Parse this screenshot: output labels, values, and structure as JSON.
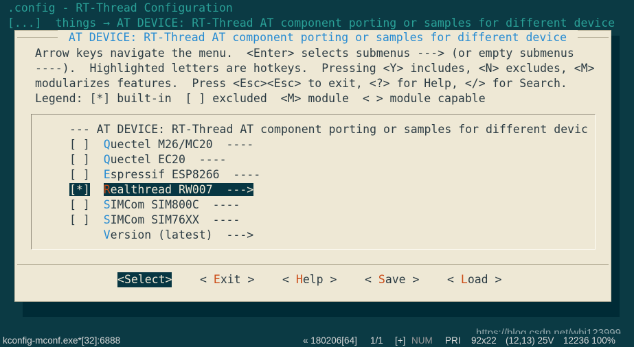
{
  "window": {
    "title": ".config - RT-Thread Configuration",
    "breadcrumb": "[...]  things → AT DEVICE: RT-Thread AT component porting or samples for different device"
  },
  "dialog": {
    "title": " AT DEVICE: RT-Thread AT component porting or samples for different device ",
    "help_lines": [
      "Arrow keys navigate the menu.  <Enter> selects submenus ---> (or empty submenus",
      "----).  Highlighted letters are hotkeys.  Pressing <Y> includes, <N> excludes, <M>",
      "modularizes features.  Press <Esc><Esc> to exit, <?> for Help, </> for Search.",
      "Legend: [*] built-in  [ ] excluded  <M> module  < > module capable"
    ],
    "menu_header": "--- AT DEVICE: RT-Thread AT component porting or samples for different devic",
    "menu_items": [
      {
        "box": "[ ]",
        "hotkey": "Q",
        "label": "uectel M26/MC20  ----"
      },
      {
        "box": "[ ]",
        "hotkey": "Q",
        "label": "uectel EC20  ----"
      },
      {
        "box": "[ ]",
        "hotkey": "E",
        "label": "spressif ESP8266  ----"
      },
      {
        "box": "[*]",
        "hotkey": "R",
        "label": "ealthread RW007  --->"
      },
      {
        "box": "[ ]",
        "hotkey": "S",
        "label": "IMCom SIM800C  ----"
      },
      {
        "box": "[ ]",
        "hotkey": "S",
        "label": "IMCom SIM76XX  ----"
      },
      {
        "box": "",
        "hotkey": "V",
        "label": "ersion (latest)  --->"
      }
    ],
    "buttons": [
      {
        "pre": "<",
        "hotkey": "S",
        "post": "elect>"
      },
      {
        "pre": "< ",
        "hotkey": "E",
        "post": "xit >"
      },
      {
        "pre": "< ",
        "hotkey": "H",
        "post": "elp >"
      },
      {
        "pre": "< ",
        "hotkey": "S",
        "post": "ave >"
      },
      {
        "pre": "< ",
        "hotkey": "L",
        "post": "oad >"
      }
    ]
  },
  "statusbar": {
    "process": "kconfig-mconf.exe*[32]:6888",
    "position": "« 180206[64]",
    "page": "1/1",
    "ins": "[+]",
    "num": "NUM",
    "pri": "PRI",
    "size": "92x22",
    "cursor": "(12,13) 25V",
    "mem": "12236 100%"
  },
  "watermark": "https://blog.csdn.net/whj123999",
  "colors": {
    "terminal_bg": "#073642",
    "dialog_bg": "#eee8d5",
    "accent": "#268bd2",
    "hotkey_selected": "#cb4b16",
    "selection_bg": "#073642"
  }
}
